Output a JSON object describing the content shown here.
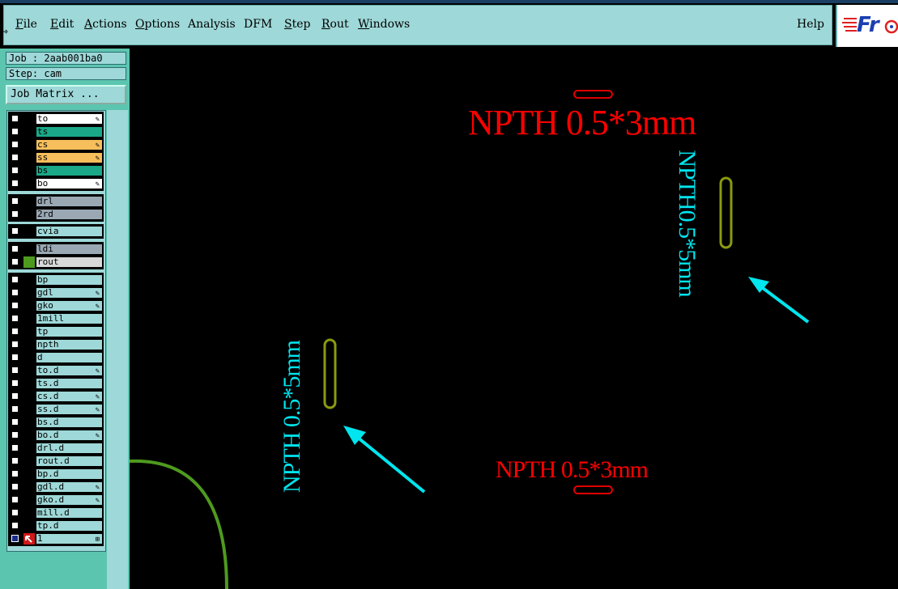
{
  "menubar": {
    "items": [
      {
        "label": "File",
        "ul": "F",
        "rest": "ile"
      },
      {
        "label": "Edit",
        "ul": "E",
        "rest": "dit"
      },
      {
        "label": "Actions",
        "ul": "A",
        "rest": "ctions"
      },
      {
        "label": "Options",
        "ul": "O",
        "rest": "ptions"
      },
      {
        "label": "Analysis",
        "ul": "",
        "rest": "Analysis"
      },
      {
        "label": "DFM",
        "ul": "",
        "rest": "DFM"
      },
      {
        "label": "Step",
        "ul": "S",
        "rest": "tep"
      },
      {
        "label": "Rout",
        "ul": "R",
        "rest": "out"
      },
      {
        "label": "Windows",
        "ul": "W",
        "rest": "indows"
      }
    ],
    "help": "Help",
    "logo_text": "Fr"
  },
  "panel": {
    "job": "Job : 2aab001ba0",
    "step": "Step: cam",
    "job_matrix": "Job Matrix ...",
    "layers": [
      {
        "name": "to",
        "color": "#ffffff",
        "edit": true
      },
      {
        "name": "ts",
        "color": "#1aa888",
        "edit": false
      },
      {
        "name": "cs",
        "color": "#f6bf5c",
        "edit": true
      },
      {
        "name": "ss",
        "color": "#f6bf5c",
        "edit": true
      },
      {
        "name": "bs",
        "color": "#1aa888",
        "edit": false
      },
      {
        "name": "bo",
        "color": "#ffffff",
        "edit": true
      },
      {
        "name": "drl",
        "color": "#9aa8b4",
        "edit": false
      },
      {
        "name": "2rd",
        "color": "#9aa8b4",
        "edit": false
      },
      {
        "name": "cvia",
        "color": "#9ed8d8",
        "edit": false
      },
      {
        "name": "ldi",
        "color": "#9aa8b4",
        "edit": false
      },
      {
        "name": "rout",
        "color": "#d8d8d8",
        "edit": false,
        "mark": "#4e9a1e"
      },
      {
        "name": "bp",
        "color": "#9ed8d8",
        "edit": false
      },
      {
        "name": "gdl",
        "color": "#9ed8d8",
        "edit": true
      },
      {
        "name": "gko",
        "color": "#9ed8d8",
        "edit": true
      },
      {
        "name": "1mill",
        "color": "#9ed8d8",
        "edit": false
      },
      {
        "name": "tp",
        "color": "#9ed8d8",
        "edit": false
      },
      {
        "name": "npth",
        "color": "#9ed8d8",
        "edit": false
      },
      {
        "name": "d",
        "color": "#9ed8d8",
        "edit": false
      },
      {
        "name": "to.d",
        "color": "#9ed8d8",
        "edit": true
      },
      {
        "name": "ts.d",
        "color": "#9ed8d8",
        "edit": false
      },
      {
        "name": "cs.d",
        "color": "#9ed8d8",
        "edit": true
      },
      {
        "name": "ss.d",
        "color": "#9ed8d8",
        "edit": true
      },
      {
        "name": "bs.d",
        "color": "#9ed8d8",
        "edit": false
      },
      {
        "name": "bo.d",
        "color": "#9ed8d8",
        "edit": true
      },
      {
        "name": "drl.d",
        "color": "#9ed8d8",
        "edit": false
      },
      {
        "name": "rout.d",
        "color": "#9ed8d8",
        "edit": false
      },
      {
        "name": "bp.d",
        "color": "#9ed8d8",
        "edit": false
      },
      {
        "name": "gdl.d",
        "color": "#9ed8d8",
        "edit": true
      },
      {
        "name": "gko.d",
        "color": "#9ed8d8",
        "edit": true
      },
      {
        "name": "mill.d",
        "color": "#9ed8d8",
        "edit": false
      },
      {
        "name": "tp.d",
        "color": "#9ed8d8",
        "edit": false
      },
      {
        "name": "1",
        "color": "#9ed8d8",
        "edit": false,
        "special": true
      }
    ]
  },
  "canvas": {
    "label_top": "NPTH  0.5*3mm",
    "label_right": "NPTH0.5*5mm",
    "label_left": "NPTH  0.5*5mm",
    "label_bottom": "NPTH  0.5*3mm"
  },
  "colors": {
    "menu_bg": "#9ed8d8",
    "panel_bg": "#5cc5b0",
    "red_text": "#ff0000",
    "cyan_text": "#00ffff",
    "slot_outline": "#8a9a10",
    "rout_green": "#4e9a1e"
  }
}
